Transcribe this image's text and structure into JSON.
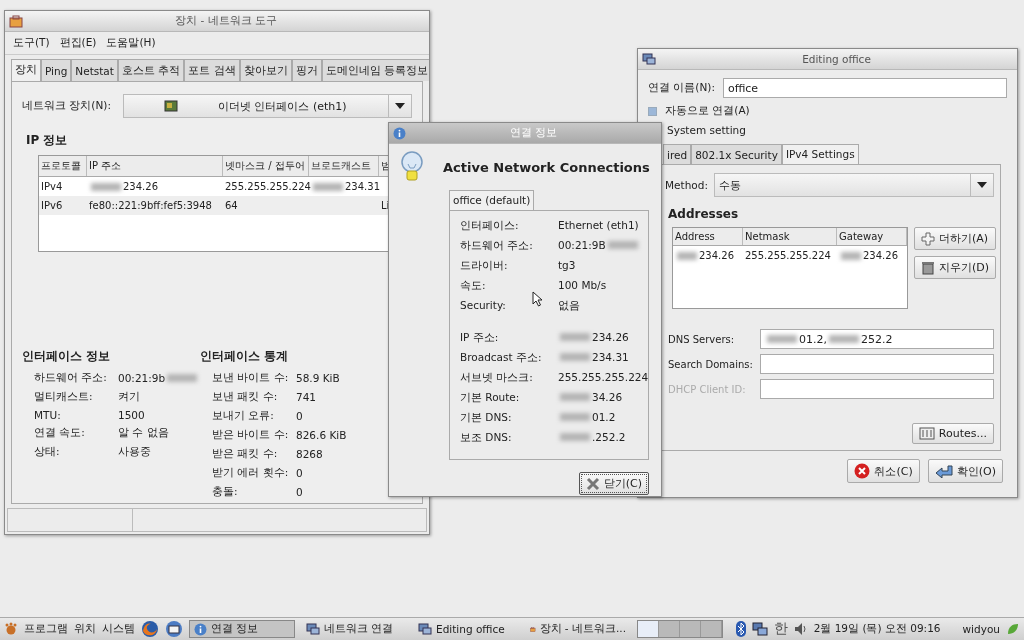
{
  "left_window": {
    "title": "장치 - 네트워크 도구",
    "menu": [
      "도구(T)",
      "편집(E)",
      "도움말(H)"
    ],
    "tabs": [
      {
        "label": "장치",
        "selected": true
      },
      {
        "label": "Ping",
        "selected": false
      },
      {
        "label": "Netstat",
        "selected": false
      },
      {
        "label": "호스트 추적",
        "selected": false
      },
      {
        "label": "포트 검색",
        "selected": false
      },
      {
        "label": "찾아보기",
        "selected": false
      },
      {
        "label": "핑거",
        "selected": false
      },
      {
        "label": "도메인네임 등록정보",
        "selected": false
      }
    ],
    "device": {
      "label": "네트워크 장치(N):",
      "value": "이더넷 인터페이스 (eth1)"
    },
    "ip_info": {
      "title": "IP 정보",
      "columns": [
        "프로토콜",
        "IP 주소",
        "넷마스크 / 접두어",
        "브로드캐스트",
        "범"
      ],
      "rows": [
        {
          "protocol": "IPv4",
          "address": {
            "text": "234.26",
            "blur_before": true
          },
          "netmask": "255.255.255.224",
          "broadcast": {
            "text": "234.31",
            "blur_before": true
          }
        },
        {
          "protocol": "IPv6",
          "address": "fe80::221:9bff:fef5:3948",
          "netmask": "64",
          "scope": "Li"
        }
      ]
    },
    "interface_info": {
      "title": "인터페이스 정보",
      "rows": [
        {
          "label": "하드웨어 주소:",
          "value": {
            "text": "00:21:9b",
            "blur_after": true
          }
        },
        {
          "label": "멀티캐스트:",
          "value": "켜기"
        },
        {
          "label": "MTU:",
          "value": "1500"
        },
        {
          "label": "연결 속도:",
          "value": "알 수 없음"
        },
        {
          "label": "상태:",
          "value": "사용중"
        }
      ]
    },
    "interface_stats": {
      "title": "인터페이스 통계",
      "rows": [
        {
          "label": "보낸 바이트 수:",
          "value": "58.9 KiB"
        },
        {
          "label": "보낸 패킷 수:",
          "value": "741"
        },
        {
          "label": "보내기 오류:",
          "value": "0"
        },
        {
          "label": "받은 바이트 수:",
          "value": "826.6 KiB"
        },
        {
          "label": "받은 패킷 수:",
          "value": "8268"
        },
        {
          "label": "받기 에러 횟수:",
          "value": "0"
        },
        {
          "label": "충돌:",
          "value": "0"
        }
      ]
    }
  },
  "info_dialog": {
    "title": "연결 정보",
    "heading": "Active Network Connections",
    "tab": "office (default)",
    "groups": [
      [
        {
          "label": "인터페이스:",
          "value": "Ethernet (eth1)"
        },
        {
          "label": "하드웨어 주소:",
          "value": {
            "text": "00:21:9B",
            "blur_after": true
          }
        },
        {
          "label": "드라이버:",
          "value": "tg3"
        },
        {
          "label": "속도:",
          "value": "100 Mb/s"
        },
        {
          "label": "Security:",
          "value": "없음"
        }
      ],
      [
        {
          "label": "IP 주소:",
          "value": {
            "text": "234.26",
            "blur_before": true
          }
        },
        {
          "label": "Broadcast 주소:",
          "value": {
            "text": "234.31",
            "blur_before": true
          }
        },
        {
          "label": "서브넷 마스크:",
          "value": "255.255.255.224"
        },
        {
          "label": "기본 Route:",
          "value": {
            "text": "34.26",
            "blur_before": true
          }
        },
        {
          "label": "기본 DNS:",
          "value": {
            "text": "01.2",
            "blur_before": true
          }
        },
        {
          "label": "보조 DNS:",
          "value": {
            "text": ".252.2",
            "blur_before": true
          }
        }
      ]
    ],
    "close_button": "닫기(C)"
  },
  "edit_window": {
    "title": "Editing office",
    "name_label": "연결 이름(N):",
    "name_value": "office",
    "auto_connect": {
      "label": "자동으로 연결(A)",
      "checked": true
    },
    "system_setting": "System setting",
    "tabs": [
      {
        "label": "ired",
        "selected": false
      },
      {
        "label": "802.1x Security",
        "selected": false
      },
      {
        "label": "IPv4 Settings",
        "selected": true
      }
    ],
    "method": {
      "label": "Method:",
      "value": "수동"
    },
    "addresses": {
      "title": "Addresses",
      "columns": [
        "Address",
        "Netmask",
        "Gateway"
      ],
      "rows": [
        [
          {
            "text": "234.26",
            "blur_before": true
          },
          "255.255.255.224",
          {
            "text": "234.26",
            "blur_before": true
          }
        ]
      ]
    },
    "add_button": "더하기(A)",
    "delete_button": "지우기(D)",
    "fields": [
      {
        "label": "DNS Servers:",
        "value": [
          {
            "text": "01.2,",
            "blur_before": true
          },
          {
            "text": "252.2",
            "blur_before": true
          }
        ],
        "disabled": false
      },
      {
        "label": "Search Domains:",
        "disabled": false
      },
      {
        "label": "DHCP Client ID:",
        "disabled": true
      }
    ],
    "routes_button": "Routes...",
    "cancel_button": "취소(C)",
    "ok_button": "확인(O)"
  },
  "taskbar": {
    "menus": [
      "프로그램",
      "위치",
      "시스템"
    ],
    "tasks": [
      {
        "label": "연결 정보",
        "kind": "info",
        "selected": true
      },
      {
        "label": "네트워크 연결",
        "kind": "network",
        "selected": false
      },
      {
        "label": "Editing office",
        "kind": "network",
        "selected": false
      },
      {
        "label": "장치 - 네트워크...",
        "kind": "tool",
        "selected": false
      }
    ],
    "workspaces": [
      {
        "selected": true
      },
      {
        "selected": false
      },
      {
        "selected": false
      },
      {
        "selected": false
      }
    ],
    "input_method": "한",
    "clock": "2월 19일 (목) 오전 09:16",
    "user": "widyou"
  }
}
